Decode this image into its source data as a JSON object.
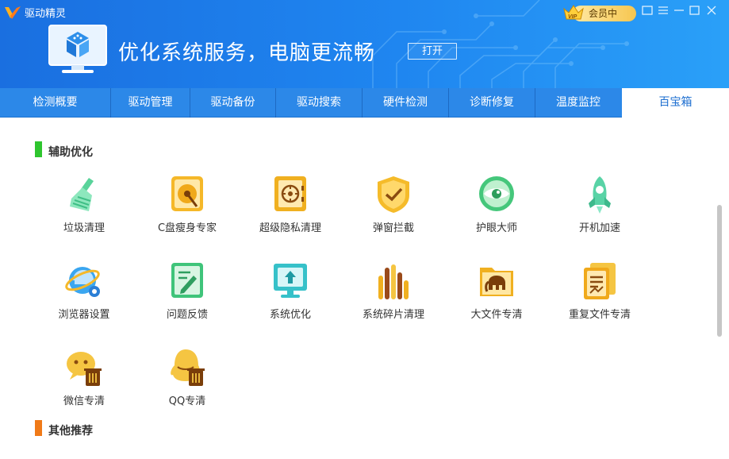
{
  "app": {
    "title": "驱动精灵"
  },
  "banner": {
    "headline": "优化系统服务，电脑更流畅",
    "open_button": "打开"
  },
  "vip": {
    "label": "会员中"
  },
  "tabs": [
    {
      "label": "检测概要"
    },
    {
      "label": "驱动管理"
    },
    {
      "label": "驱动备份"
    },
    {
      "label": "驱动搜索"
    },
    {
      "label": "硬件检测"
    },
    {
      "label": "诊断修复"
    },
    {
      "label": "温度监控"
    },
    {
      "label": "百宝箱"
    }
  ],
  "active_tab": "百宝箱",
  "sections": [
    {
      "title": "辅助优化",
      "color": "#2ec52e"
    },
    {
      "title": "其他推荐",
      "color": "#f07a18"
    }
  ],
  "tools": [
    {
      "label": "垃圾清理",
      "icon": "broom-icon"
    },
    {
      "label": "C盘瘦身专家",
      "icon": "disk-slim-icon"
    },
    {
      "label": "超级隐私清理",
      "icon": "safe-icon"
    },
    {
      "label": "弹窗拦截",
      "icon": "shield-check-icon"
    },
    {
      "label": "护眼大师",
      "icon": "eye-icon"
    },
    {
      "label": "开机加速",
      "icon": "rocket-icon"
    },
    {
      "label": "浏览器设置",
      "icon": "browser-gear-icon"
    },
    {
      "label": "问题反馈",
      "icon": "feedback-icon"
    },
    {
      "label": "系统优化",
      "icon": "monitor-up-icon"
    },
    {
      "label": "系统碎片清理",
      "icon": "defrag-icon"
    },
    {
      "label": "大文件专清",
      "icon": "elephant-folder-icon"
    },
    {
      "label": "重复文件专清",
      "icon": "duplicate-file-icon"
    },
    {
      "label": "微信专清",
      "icon": "wechat-clean-icon"
    },
    {
      "label": "QQ专清",
      "icon": "qq-clean-icon"
    }
  ],
  "colors": {
    "header": "#1f86f0",
    "tabbar": "#2c88e8",
    "accent_blue": "#1e6fd0",
    "gold": "#f0b020"
  }
}
